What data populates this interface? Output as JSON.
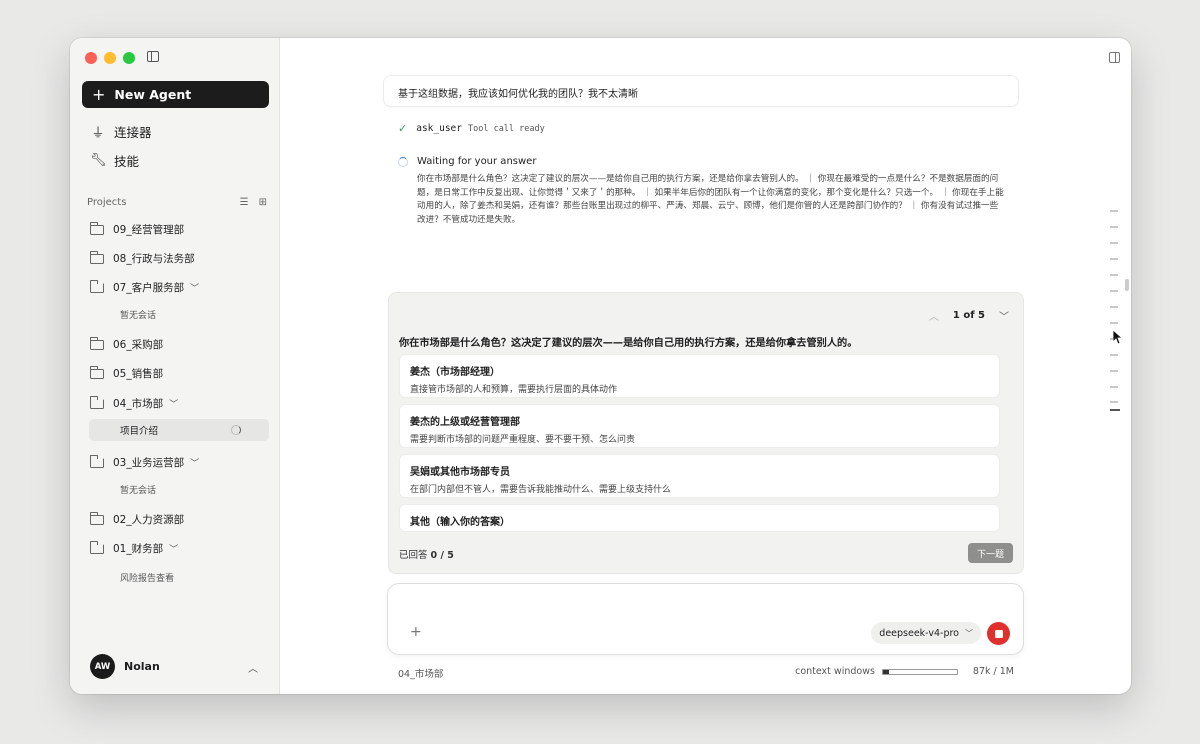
{
  "sidebar": {
    "new_agent_label": "New Agent",
    "nav": [
      {
        "label": "连接器",
        "icon": "plug-icon"
      },
      {
        "label": "技能",
        "icon": "wrench-icon"
      }
    ],
    "projects_title": "Projects",
    "projects": [
      {
        "label": "09_经营管理部"
      },
      {
        "label": "08_行政与法务部"
      },
      {
        "label": "07_客户服务部",
        "expanded": true,
        "sub": "暂无会话"
      },
      {
        "label": "06_采购部"
      },
      {
        "label": "05_销售部"
      },
      {
        "label": "04_市场部",
        "expanded": true,
        "sub": "项目介绍"
      },
      {
        "label": "03_业务运营部",
        "expanded": true,
        "sub": "暂无会话"
      },
      {
        "label": "02_人力资源部"
      },
      {
        "label": "01_财务部",
        "expanded": true,
        "sub": "风险报告查看"
      }
    ],
    "user": {
      "initials": "AW",
      "name": "Nolan"
    }
  },
  "chat": {
    "user_message": "基于这组数据，我应该如何优化我的团队？我不太清晰",
    "tool_call": {
      "name": "ask_user",
      "status": "Tool call ready"
    },
    "waiting_label": "Waiting for your answer",
    "waiting_text": "你在市场部是什么角色？这决定了建议的层次——是给你自己用的执行方案，还是给你拿去管别人的。 ｜ 你现在最难受的一点是什么？不是数据层面的问题，是日常工作中反复出现、让你觉得＇又来了＇的那种。 ｜ 如果半年后你的团队有一个让你满意的变化，那个变化是什么？只选一个。 ｜ 你现在手上能动用的人，除了姜杰和吴娟，还有谁？那些台账里出现过的柳平、严涛、郑晨、云宁、顾博，他们是你管的人还是跨部门协作的？ ｜ 你有没有试过推一些改进？不管成功还是失败。"
  },
  "question_panel": {
    "pager": "1 of 5",
    "question": "你在市场部是什么角色？这决定了建议的层次——是给你自己用的执行方案，还是给你拿去管别人的。",
    "options": [
      {
        "title": "姜杰（市场部经理）",
        "desc": "直接管市场部的人和预算，需要执行层面的具体动作"
      },
      {
        "title": "姜杰的上级或经营管理部",
        "desc": "需要判断市场部的问题严重程度、要不要干预、怎么问责"
      },
      {
        "title": "吴娟或其他市场部专员",
        "desc": "在部门内部但不管人，需要告诉我能推动什么、需要上级支持什么"
      },
      {
        "title": "其他（输入你的答案）",
        "desc": ""
      }
    ],
    "answered_label": "已回答",
    "answered_count": "0 / 5",
    "next_label": "下一题"
  },
  "composer": {
    "model": "deepseek-v4-pro",
    "project": "04_市场部",
    "context_label": "context windows",
    "context_used_fraction": 0.087,
    "context_count": "87k / 1M"
  },
  "colors": {
    "accent_dark": "#1c1c1c",
    "stop": "#e0302e",
    "check": "#2e9e5b",
    "spinner": "#3a6fd1"
  }
}
